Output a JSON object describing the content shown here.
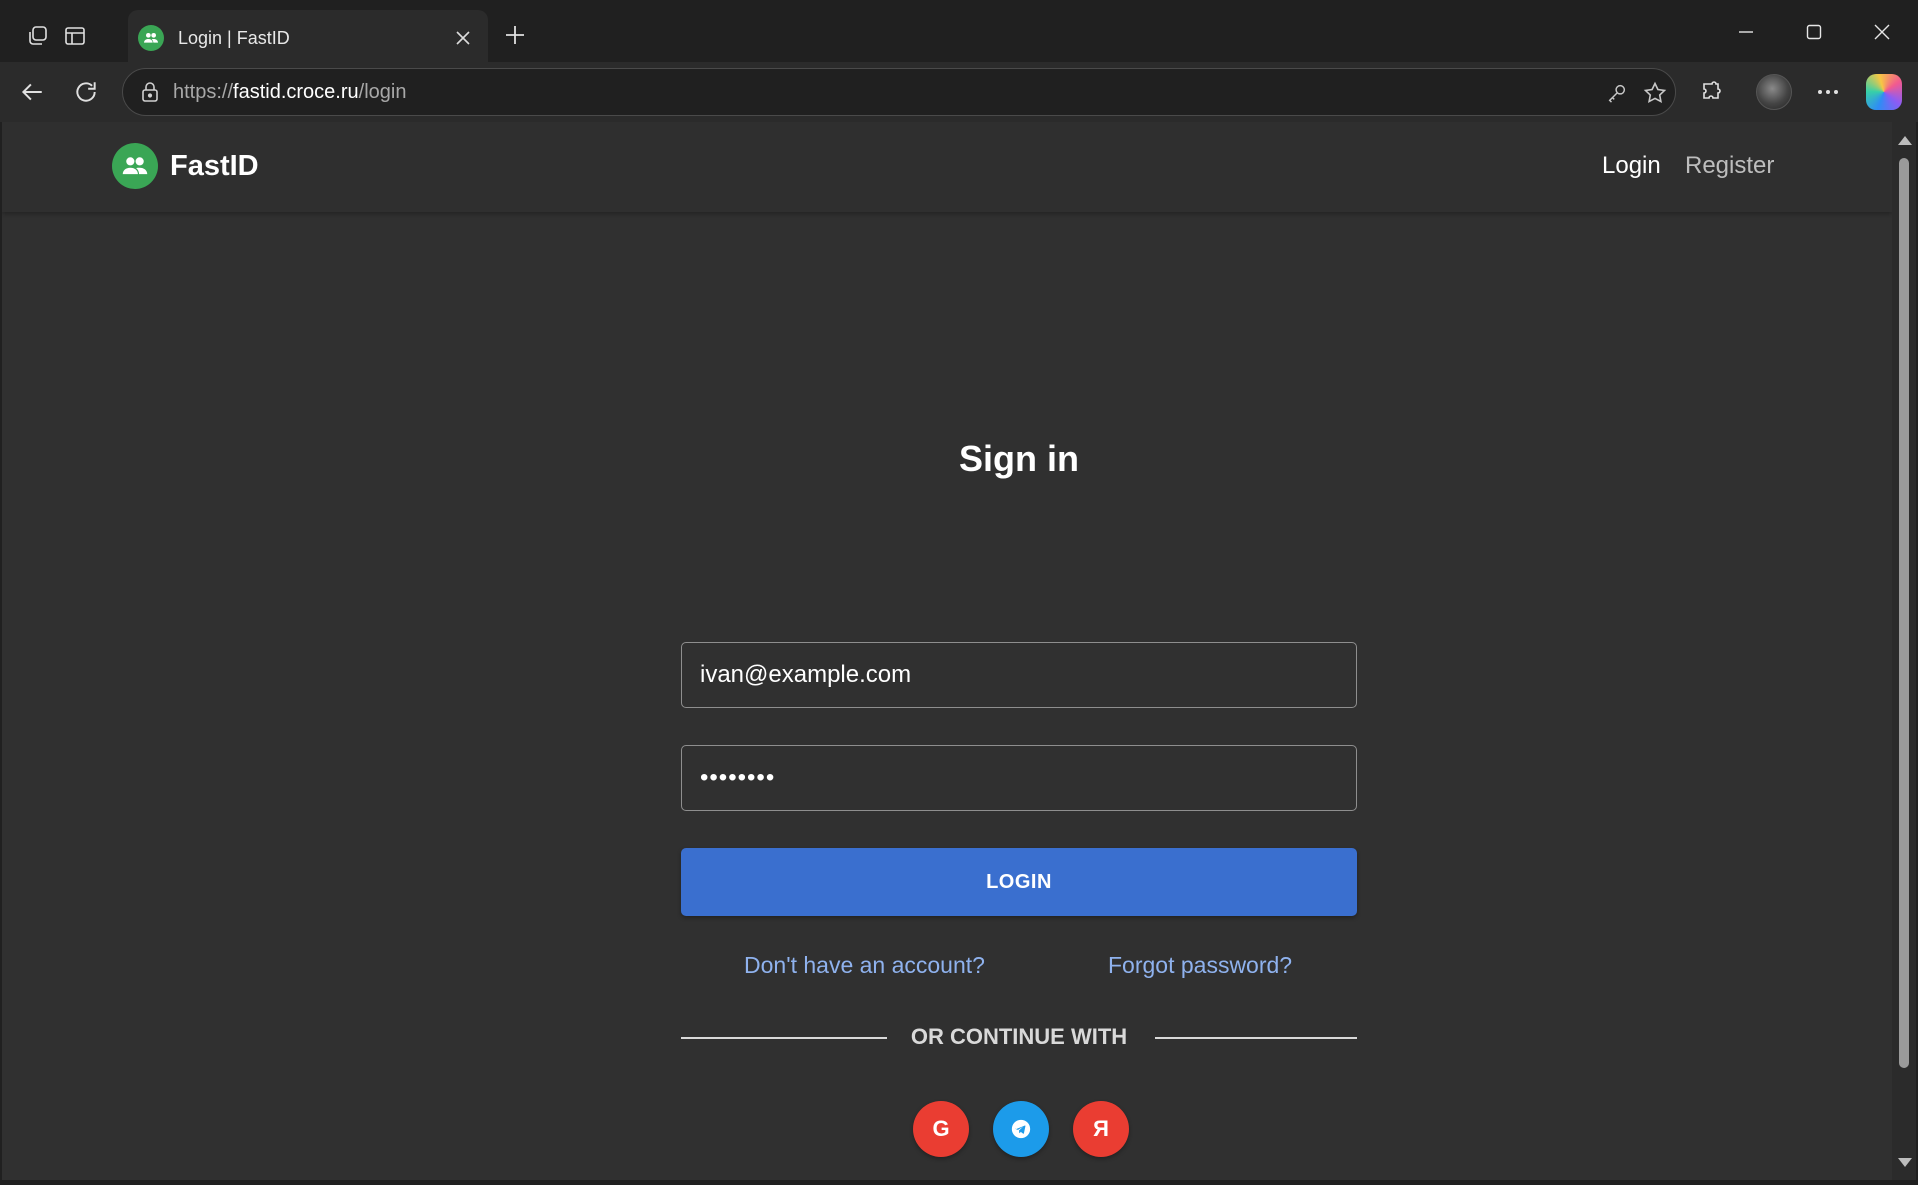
{
  "browser": {
    "tab": {
      "title": "Login | FastID",
      "favicon_icon": "users-icon",
      "favicon_color": "#3aa655"
    },
    "address": {
      "scheme": "https://",
      "host": "fastid.croce.ru",
      "path": "/login"
    },
    "window_controls": [
      "minimize",
      "maximize",
      "close"
    ]
  },
  "app": {
    "brand": {
      "name": "FastID",
      "logo_icon": "users-icon",
      "color": "#3aa655"
    },
    "nav": {
      "login": "Login",
      "register": "Register"
    }
  },
  "form": {
    "title": "Sign in",
    "email_value": "ivan@example.com",
    "password_value": "••••••••",
    "login_button": "LOGIN",
    "register_link": "Don't have an account?",
    "forgot_link": "Forgot password?",
    "divider_text": "OR CONTINUE WITH",
    "accent_color": "#3a6fcf"
  },
  "social": {
    "google": {
      "label": "G",
      "color": "#ea3d32"
    },
    "telegram": {
      "icon": "telegram-icon",
      "color": "#1c9bea"
    },
    "yandex": {
      "label": "Я",
      "color": "#ea3d32"
    }
  }
}
